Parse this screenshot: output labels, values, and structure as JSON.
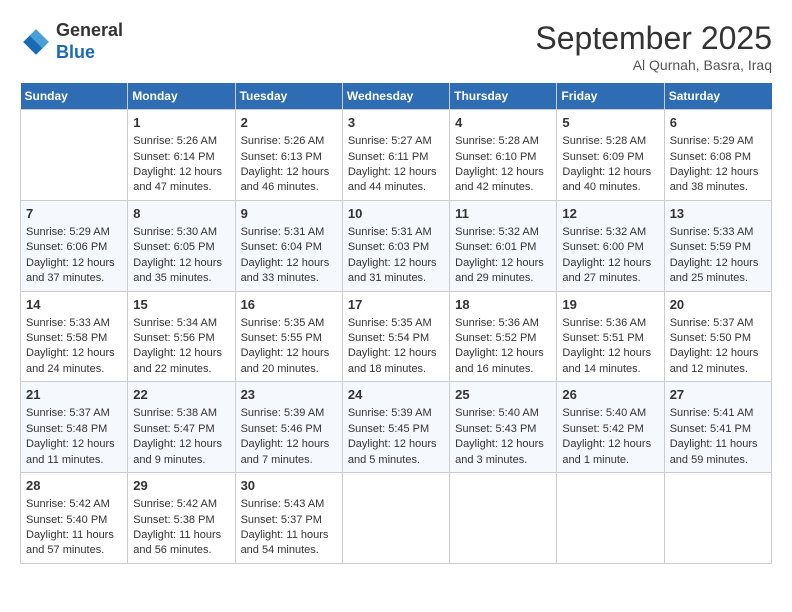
{
  "header": {
    "logo_line1": "General",
    "logo_line2": "Blue",
    "month": "September 2025",
    "location": "Al Qurnah, Basra, Iraq"
  },
  "days_of_week": [
    "Sunday",
    "Monday",
    "Tuesday",
    "Wednesday",
    "Thursday",
    "Friday",
    "Saturday"
  ],
  "weeks": [
    [
      {
        "day": "",
        "empty": true
      },
      {
        "day": "1",
        "sunrise": "5:26 AM",
        "sunset": "6:14 PM",
        "daylight": "12 hours and 47 minutes."
      },
      {
        "day": "2",
        "sunrise": "5:26 AM",
        "sunset": "6:13 PM",
        "daylight": "12 hours and 46 minutes."
      },
      {
        "day": "3",
        "sunrise": "5:27 AM",
        "sunset": "6:11 PM",
        "daylight": "12 hours and 44 minutes."
      },
      {
        "day": "4",
        "sunrise": "5:28 AM",
        "sunset": "6:10 PM",
        "daylight": "12 hours and 42 minutes."
      },
      {
        "day": "5",
        "sunrise": "5:28 AM",
        "sunset": "6:09 PM",
        "daylight": "12 hours and 40 minutes."
      },
      {
        "day": "6",
        "sunrise": "5:29 AM",
        "sunset": "6:08 PM",
        "daylight": "12 hours and 38 minutes."
      }
    ],
    [
      {
        "day": "7",
        "sunrise": "5:29 AM",
        "sunset": "6:06 PM",
        "daylight": "12 hours and 37 minutes."
      },
      {
        "day": "8",
        "sunrise": "5:30 AM",
        "sunset": "6:05 PM",
        "daylight": "12 hours and 35 minutes."
      },
      {
        "day": "9",
        "sunrise": "5:31 AM",
        "sunset": "6:04 PM",
        "daylight": "12 hours and 33 minutes."
      },
      {
        "day": "10",
        "sunrise": "5:31 AM",
        "sunset": "6:03 PM",
        "daylight": "12 hours and 31 minutes."
      },
      {
        "day": "11",
        "sunrise": "5:32 AM",
        "sunset": "6:01 PM",
        "daylight": "12 hours and 29 minutes."
      },
      {
        "day": "12",
        "sunrise": "5:32 AM",
        "sunset": "6:00 PM",
        "daylight": "12 hours and 27 minutes."
      },
      {
        "day": "13",
        "sunrise": "5:33 AM",
        "sunset": "5:59 PM",
        "daylight": "12 hours and 25 minutes."
      }
    ],
    [
      {
        "day": "14",
        "sunrise": "5:33 AM",
        "sunset": "5:58 PM",
        "daylight": "12 hours and 24 minutes."
      },
      {
        "day": "15",
        "sunrise": "5:34 AM",
        "sunset": "5:56 PM",
        "daylight": "12 hours and 22 minutes."
      },
      {
        "day": "16",
        "sunrise": "5:35 AM",
        "sunset": "5:55 PM",
        "daylight": "12 hours and 20 minutes."
      },
      {
        "day": "17",
        "sunrise": "5:35 AM",
        "sunset": "5:54 PM",
        "daylight": "12 hours and 18 minutes."
      },
      {
        "day": "18",
        "sunrise": "5:36 AM",
        "sunset": "5:52 PM",
        "daylight": "12 hours and 16 minutes."
      },
      {
        "day": "19",
        "sunrise": "5:36 AM",
        "sunset": "5:51 PM",
        "daylight": "12 hours and 14 minutes."
      },
      {
        "day": "20",
        "sunrise": "5:37 AM",
        "sunset": "5:50 PM",
        "daylight": "12 hours and 12 minutes."
      }
    ],
    [
      {
        "day": "21",
        "sunrise": "5:37 AM",
        "sunset": "5:48 PM",
        "daylight": "12 hours and 11 minutes."
      },
      {
        "day": "22",
        "sunrise": "5:38 AM",
        "sunset": "5:47 PM",
        "daylight": "12 hours and 9 minutes."
      },
      {
        "day": "23",
        "sunrise": "5:39 AM",
        "sunset": "5:46 PM",
        "daylight": "12 hours and 7 minutes."
      },
      {
        "day": "24",
        "sunrise": "5:39 AM",
        "sunset": "5:45 PM",
        "daylight": "12 hours and 5 minutes."
      },
      {
        "day": "25",
        "sunrise": "5:40 AM",
        "sunset": "5:43 PM",
        "daylight": "12 hours and 3 minutes."
      },
      {
        "day": "26",
        "sunrise": "5:40 AM",
        "sunset": "5:42 PM",
        "daylight": "12 hours and 1 minute."
      },
      {
        "day": "27",
        "sunrise": "5:41 AM",
        "sunset": "5:41 PM",
        "daylight": "11 hours and 59 minutes."
      }
    ],
    [
      {
        "day": "28",
        "sunrise": "5:42 AM",
        "sunset": "5:40 PM",
        "daylight": "11 hours and 57 minutes."
      },
      {
        "day": "29",
        "sunrise": "5:42 AM",
        "sunset": "5:38 PM",
        "daylight": "11 hours and 56 minutes."
      },
      {
        "day": "30",
        "sunrise": "5:43 AM",
        "sunset": "5:37 PM",
        "daylight": "11 hours and 54 minutes."
      },
      {
        "day": "",
        "empty": true
      },
      {
        "day": "",
        "empty": true
      },
      {
        "day": "",
        "empty": true
      },
      {
        "day": "",
        "empty": true
      }
    ]
  ]
}
